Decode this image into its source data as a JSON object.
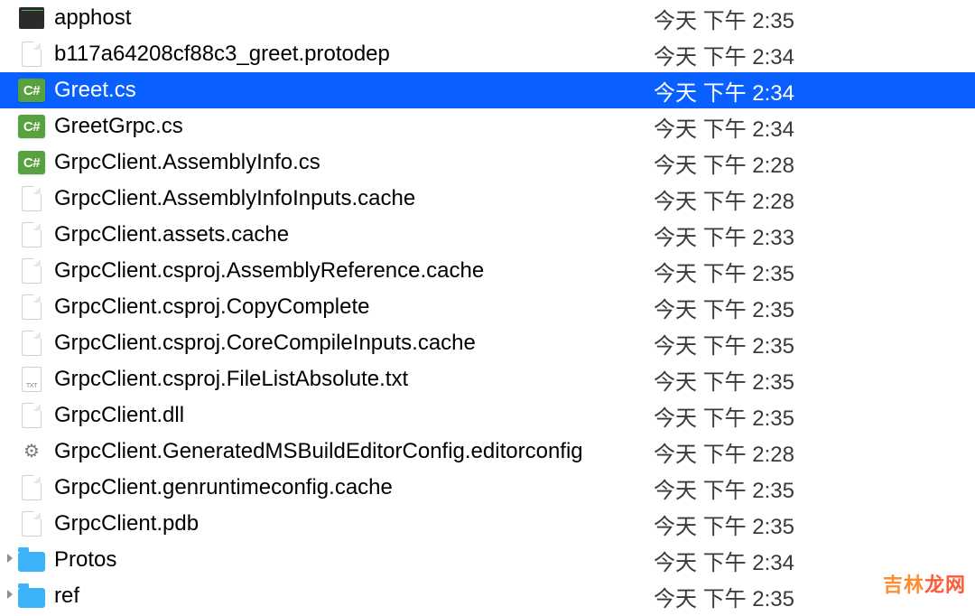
{
  "watermark": {
    "p1": "吉林",
    "p2": "龙网"
  },
  "rows": [
    {
      "icon": "exec",
      "name": "apphost",
      "date": "今天 下午 2:35",
      "selected": false,
      "folder": false
    },
    {
      "icon": "generic",
      "name": "b117a64208cf88c3_greet.protodep",
      "date": "今天 下午 2:34",
      "selected": false,
      "folder": false
    },
    {
      "icon": "cs",
      "name": "Greet.cs",
      "date": "今天 下午 2:34",
      "selected": true,
      "folder": false
    },
    {
      "icon": "cs",
      "name": "GreetGrpc.cs",
      "date": "今天 下午 2:34",
      "selected": false,
      "folder": false
    },
    {
      "icon": "cs",
      "name": "GrpcClient.AssemblyInfo.cs",
      "date": "今天 下午 2:28",
      "selected": false,
      "folder": false
    },
    {
      "icon": "generic",
      "name": "GrpcClient.AssemblyInfoInputs.cache",
      "date": "今天 下午 2:28",
      "selected": false,
      "folder": false
    },
    {
      "icon": "generic",
      "name": "GrpcClient.assets.cache",
      "date": "今天 下午 2:33",
      "selected": false,
      "folder": false
    },
    {
      "icon": "generic",
      "name": "GrpcClient.csproj.AssemblyReference.cache",
      "date": "今天 下午 2:35",
      "selected": false,
      "folder": false
    },
    {
      "icon": "generic",
      "name": "GrpcClient.csproj.CopyComplete",
      "date": "今天 下午 2:35",
      "selected": false,
      "folder": false
    },
    {
      "icon": "generic",
      "name": "GrpcClient.csproj.CoreCompileInputs.cache",
      "date": "今天 下午 2:35",
      "selected": false,
      "folder": false
    },
    {
      "icon": "txt",
      "name": "GrpcClient.csproj.FileListAbsolute.txt",
      "date": "今天 下午 2:35",
      "selected": false,
      "folder": false
    },
    {
      "icon": "generic",
      "name": "GrpcClient.dll",
      "date": "今天 下午 2:35",
      "selected": false,
      "folder": false
    },
    {
      "icon": "gear",
      "name": "GrpcClient.GeneratedMSBuildEditorConfig.editorconfig",
      "date": "今天 下午 2:28",
      "selected": false,
      "folder": false
    },
    {
      "icon": "generic",
      "name": "GrpcClient.genruntimeconfig.cache",
      "date": "今天 下午 2:35",
      "selected": false,
      "folder": false
    },
    {
      "icon": "generic",
      "name": "GrpcClient.pdb",
      "date": "今天 下午 2:35",
      "selected": false,
      "folder": false
    },
    {
      "icon": "folder",
      "name": "Protos",
      "date": "今天 下午 2:34",
      "selected": false,
      "folder": true
    },
    {
      "icon": "folder",
      "name": "ref",
      "date": "今天 下午 2:35",
      "selected": false,
      "folder": true
    }
  ]
}
